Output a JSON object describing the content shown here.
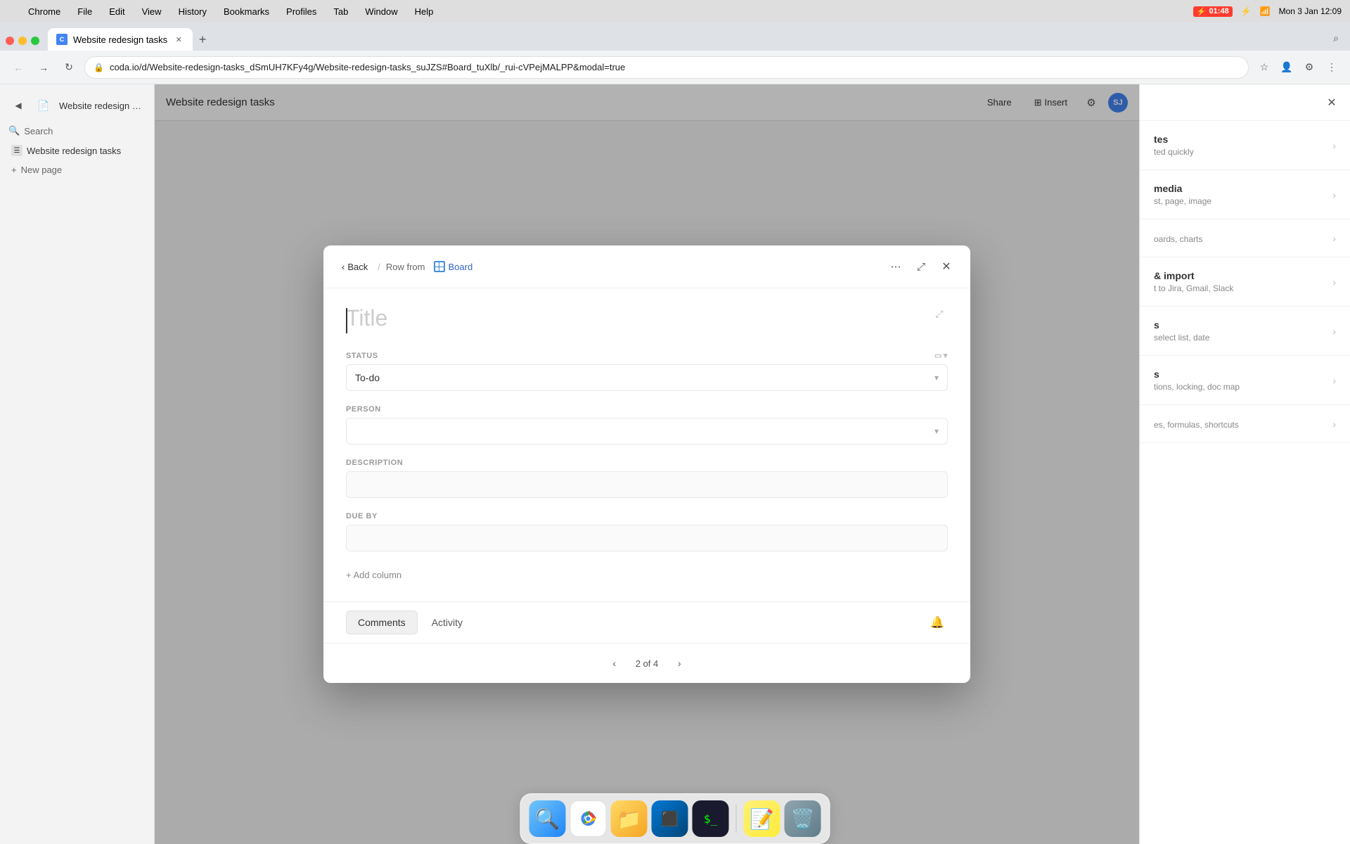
{
  "menubar": {
    "apple": "",
    "items": [
      "Chrome",
      "File",
      "Edit",
      "View",
      "History",
      "Bookmarks",
      "Profiles",
      "Tab",
      "Window",
      "Help"
    ],
    "time": "Mon 3 Jan  12:09",
    "battery": "01:48"
  },
  "browser": {
    "tab_title": "Website redesign tasks",
    "url": "coda.io/d/Website-redesign-tasks_dSmUH7KFy4g/Website-redesign-tasks_suJZS#Board_tuXlb/_rui-cVPejMALPP&modal=true",
    "profile": "Incognito"
  },
  "sidebar": {
    "search_placeholder": "Search",
    "page_title": "Website redesign tasks",
    "new_page_label": "New page"
  },
  "doc": {
    "title": "Website redesign tasks",
    "share_label": "Share",
    "insert_label": "Insert",
    "avatar_initials": "SJ"
  },
  "right_panel": {
    "items": [
      {
        "title": "tes",
        "desc": "ted quickly"
      },
      {
        "title": "media",
        "desc": "st, page, image"
      },
      {
        "title": "",
        "desc": "oards, charts"
      },
      {
        "title": "& import",
        "desc": "t to Jira, Gmail, Slack"
      },
      {
        "title": "s",
        "desc": "select list, date"
      },
      {
        "title": "s",
        "desc": "tions, locking, doc map"
      },
      {
        "title": "",
        "desc": "es, formulas, shortcuts"
      }
    ]
  },
  "modal": {
    "back_label": "Back",
    "breadcrumb_label": "Row from",
    "board_label": "Board",
    "title_placeholder": "Title",
    "fields": [
      {
        "id": "status",
        "label": "STATUS",
        "type": "select",
        "value": "To-do"
      },
      {
        "id": "person",
        "label": "PERSON",
        "type": "select",
        "value": ""
      },
      {
        "id": "description",
        "label": "DESCRIPTION",
        "type": "text",
        "value": ""
      },
      {
        "id": "due_by",
        "label": "DUE BY",
        "type": "text",
        "value": ""
      }
    ],
    "add_column_label": "+ Add column",
    "tabs": [
      "Comments",
      "Activity"
    ],
    "active_tab": "Comments",
    "pagination": {
      "current": 2,
      "total": 4,
      "label": "2 of 4"
    }
  },
  "dock": {
    "icons": [
      "🔍",
      "🌐",
      "📁",
      "💻",
      "⬛",
      "📝",
      "🗑️"
    ]
  }
}
